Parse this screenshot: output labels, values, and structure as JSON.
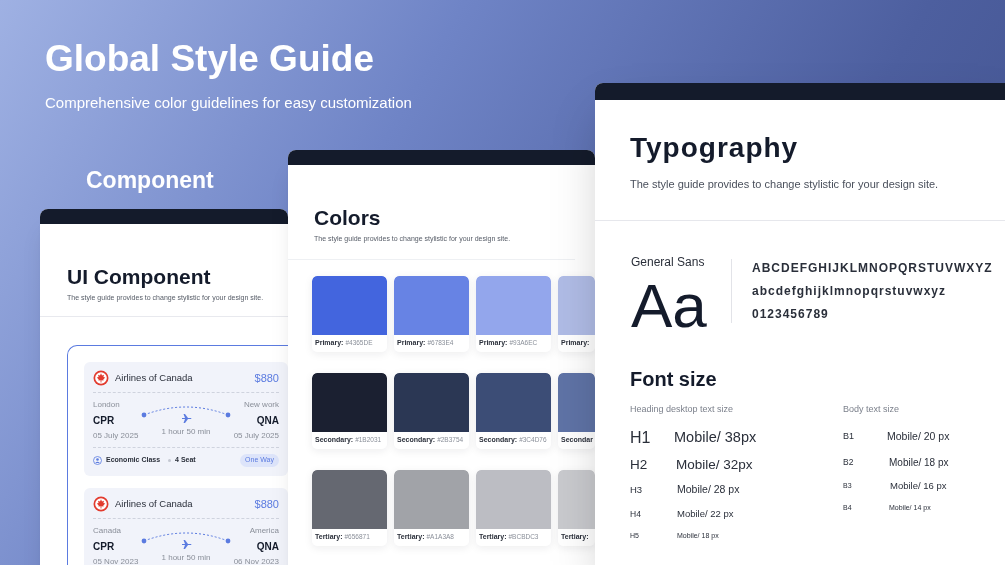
{
  "header": {
    "title": "Global Style Guide",
    "subtitle": "Comprehensive color guidelines for easy customization",
    "section_label": "Component"
  },
  "component_page": {
    "title": "UI Component",
    "subtitle": "The style guide provides to change stylistic for your design site.",
    "flights": [
      {
        "airline": "Airlines of Canada",
        "price": "$880",
        "from": {
          "city": "London",
          "code": "CPR",
          "date": "05 July 2025"
        },
        "duration": "1 hour 50 min",
        "to": {
          "city": "New work",
          "code": "QNA",
          "date": "05 July 2025"
        },
        "footer": {
          "class_label": "Economic Class",
          "seats": "4 Seat",
          "trip_type": "One Way"
        }
      },
      {
        "airline": "Airlines of Canada",
        "price": "$880",
        "from": {
          "city": "Canada",
          "code": "CPR",
          "date": "05 Nov 2023"
        },
        "duration": "1 hour 50 min",
        "to": {
          "city": "America",
          "code": "QNA",
          "date": "06 Nov 2023"
        }
      }
    ]
  },
  "colors_page": {
    "title": "Colors",
    "subtitle": "The style guide provides to change stylistic for your design site.",
    "rows": [
      {
        "swatches": [
          {
            "label": "Primary:",
            "code": "#4365DE",
            "color": "#4365de"
          },
          {
            "label": "Primary:",
            "code": "#6783E4",
            "color": "#6783e4"
          },
          {
            "label": "Primary:",
            "code": "#93A6EC",
            "color": "#93a6ec"
          },
          {
            "label": "Primary:",
            "color": "#b0bce6"
          }
        ]
      },
      {
        "swatches": [
          {
            "label": "Secondary:",
            "code": "#1B2031",
            "color": "#1b2031"
          },
          {
            "label": "Secondary:",
            "code": "#2B3754",
            "color": "#2b3754"
          },
          {
            "label": "Secondary:",
            "code": "#3C4D76",
            "color": "#3c4d76"
          },
          {
            "label": "Secondar",
            "color": "#5f73a6"
          }
        ]
      },
      {
        "swatches": [
          {
            "label": "Tertiary:",
            "code": "#656871",
            "color": "#656871"
          },
          {
            "label": "Tertiary:",
            "code": "#A1A3A8",
            "color": "#a1a3a8"
          },
          {
            "label": "Tertiary:",
            "code": "#BCBDC3",
            "color": "#bcbdc3"
          },
          {
            "label": "Tertiary:",
            "color": "#c9cace"
          }
        ]
      }
    ]
  },
  "typography_page": {
    "title": "Typography",
    "subtitle": "The style guide provides to change stylistic for your design site.",
    "font_name": "General Sans",
    "sample": "Aa",
    "glyph_lines": [
      "ABCDEFGHIJKLMNOPQRSTUVWXYZ",
      "abcdefghijklmnopqrstuvwxyz",
      "0123456789"
    ],
    "font_size": {
      "title": "Font size",
      "heading_label": "Heading desktop text size",
      "body_label": "Body text size",
      "headings": [
        {
          "tag": "H1",
          "spec": "Mobile/ 38px"
        },
        {
          "tag": "H2",
          "spec": "Mobile/ 32px"
        },
        {
          "tag": "H3",
          "spec": "Mobile/ 28 px"
        },
        {
          "tag": "H4",
          "spec": "Mobile/ 22 px"
        },
        {
          "tag": "H5",
          "spec": "Mobile/ 18 px"
        }
      ],
      "body": [
        {
          "tag": "B1",
          "spec": "Mobile/ 20 px"
        },
        {
          "tag": "B2",
          "spec": "Mobile/ 18 px"
        },
        {
          "tag": "B3",
          "spec": "Mobile/ 16 px"
        },
        {
          "tag": "B4",
          "spec": "Mobile/ 14 px"
        }
      ]
    }
  }
}
